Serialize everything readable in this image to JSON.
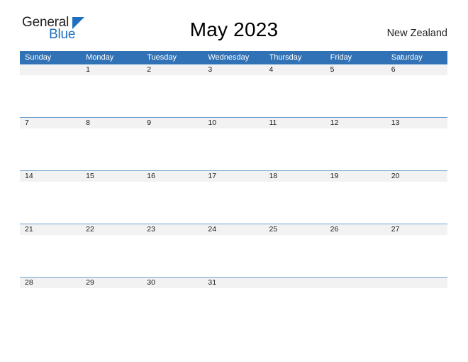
{
  "brand": {
    "name_part1": "General",
    "name_part2": "Blue",
    "triangle_icon": "triangle-icon",
    "color_dark": "#231f20",
    "color_blue": "#1f6fc0"
  },
  "header": {
    "title": "May 2023",
    "region": "New Zealand"
  },
  "theme": {
    "header_blue": "#3072b5",
    "row_border_blue": "#6f9fcf",
    "date_band_gray": "#f2f2f2",
    "text_dark": "#1a1a1a"
  },
  "calendar": {
    "weekdays": [
      "Sunday",
      "Monday",
      "Tuesday",
      "Wednesday",
      "Thursday",
      "Friday",
      "Saturday"
    ],
    "weeks": [
      [
        "",
        "1",
        "2",
        "3",
        "4",
        "5",
        "6"
      ],
      [
        "7",
        "8",
        "9",
        "10",
        "11",
        "12",
        "13"
      ],
      [
        "14",
        "15",
        "16",
        "17",
        "18",
        "19",
        "20"
      ],
      [
        "21",
        "22",
        "23",
        "24",
        "25",
        "26",
        "27"
      ],
      [
        "28",
        "29",
        "30",
        "31",
        "",
        "",
        ""
      ]
    ]
  }
}
